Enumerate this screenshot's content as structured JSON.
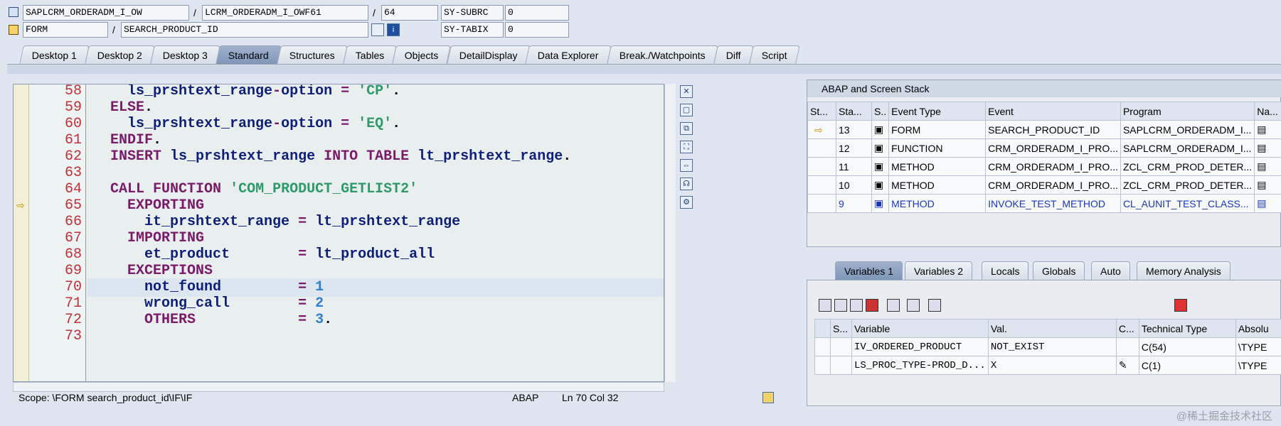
{
  "header": {
    "row1": {
      "program": "SAPLCRM_ORDERADM_I_OW",
      "include": "LCRM_ORDERADM_I_OWF61",
      "line": "64",
      "sy_label": "SY-SUBRC",
      "sy_value": "0"
    },
    "row2": {
      "type": "FORM",
      "name": "SEARCH_PRODUCT_ID",
      "sy_label": "SY-TABIX",
      "sy_value": "0"
    },
    "sep": "/"
  },
  "tabs": [
    "Desktop 1",
    "Desktop 2",
    "Desktop 3",
    "Standard",
    "Structures",
    "Tables",
    "Objects",
    "DetailDisplay",
    "Data Explorer",
    "Break./Watchpoints",
    "Diff",
    "Script"
  ],
  "active_tab": "Standard",
  "code": [
    {
      "n": "58",
      "t": "    ls_prshtext_range-option = 'CP'."
    },
    {
      "n": "59",
      "t": "  ELSE."
    },
    {
      "n": "60",
      "t": "    ls_prshtext_range-option = 'EQ'."
    },
    {
      "n": "61",
      "t": "  ENDIF."
    },
    {
      "n": "62",
      "t": "  INSERT ls_prshtext_range INTO TABLE lt_prshtext_range."
    },
    {
      "n": "63",
      "t": ""
    },
    {
      "n": "64",
      "t": "  CALL FUNCTION 'COM_PRODUCT_GETLIST2'"
    },
    {
      "n": "65",
      "t": "    EXPORTING"
    },
    {
      "n": "66",
      "t": "      it_prshtext_range = lt_prshtext_range"
    },
    {
      "n": "67",
      "t": "    IMPORTING"
    },
    {
      "n": "68",
      "t": "      et_product        = lt_product_all"
    },
    {
      "n": "69",
      "t": "    EXCEPTIONS"
    },
    {
      "n": "70",
      "t": "      not_found         = 1"
    },
    {
      "n": "71",
      "t": "      wrong_call        = 2"
    },
    {
      "n": "72",
      "t": "      OTHERS            = 3."
    },
    {
      "n": "73",
      "t": ""
    }
  ],
  "status": {
    "scope": "Scope: \\FORM search_product_id\\IF\\IF",
    "lang": "ABAP",
    "pos": "Ln  70 Col  32"
  },
  "stack": {
    "title": "ABAP and Screen Stack",
    "headers": [
      "St...",
      "Sta...",
      "S..",
      "Event Type",
      "Event",
      "Program",
      "Na..."
    ],
    "rows": [
      {
        "sta": "13",
        "type": "FORM",
        "event": "SEARCH_PRODUCT_ID",
        "program": "SAPLCRM_ORDERADM_I..."
      },
      {
        "sta": "12",
        "type": "FUNCTION",
        "event": "CRM_ORDERADM_I_PRO...",
        "program": "SAPLCRM_ORDERADM_I..."
      },
      {
        "sta": "11",
        "type": "METHOD",
        "event": "CRM_ORDERADM_I_PRO...",
        "program": "ZCL_CRM_PROD_DETER..."
      },
      {
        "sta": "10",
        "type": "METHOD",
        "event": "CRM_ORDERADM_I_PRO...",
        "program": "ZCL_CRM_PROD_DETER..."
      },
      {
        "sta": "9",
        "type": "METHOD",
        "event": "INVOKE_TEST_METHOD",
        "program": "CL_AUNIT_TEST_CLASS..."
      }
    ]
  },
  "vartabs": [
    "Variables 1",
    "Variables 2",
    "Locals",
    "Globals",
    "Auto",
    "Memory Analysis"
  ],
  "vars": {
    "headers": [
      "S...",
      "Variable",
      "Val.",
      "C...",
      "Technical Type",
      "Absolu"
    ],
    "rows": [
      {
        "name": "IV_ORDERED_PRODUCT",
        "val": "NOT_EXIST",
        "type": "C(54)",
        "abs": "\\TYPE"
      },
      {
        "name": "LS_PROC_TYPE-PROD_D...",
        "val": "X",
        "type": "C(1)",
        "abs": "\\TYPE"
      }
    ]
  },
  "watermark": "@稀土掘金技术社区"
}
